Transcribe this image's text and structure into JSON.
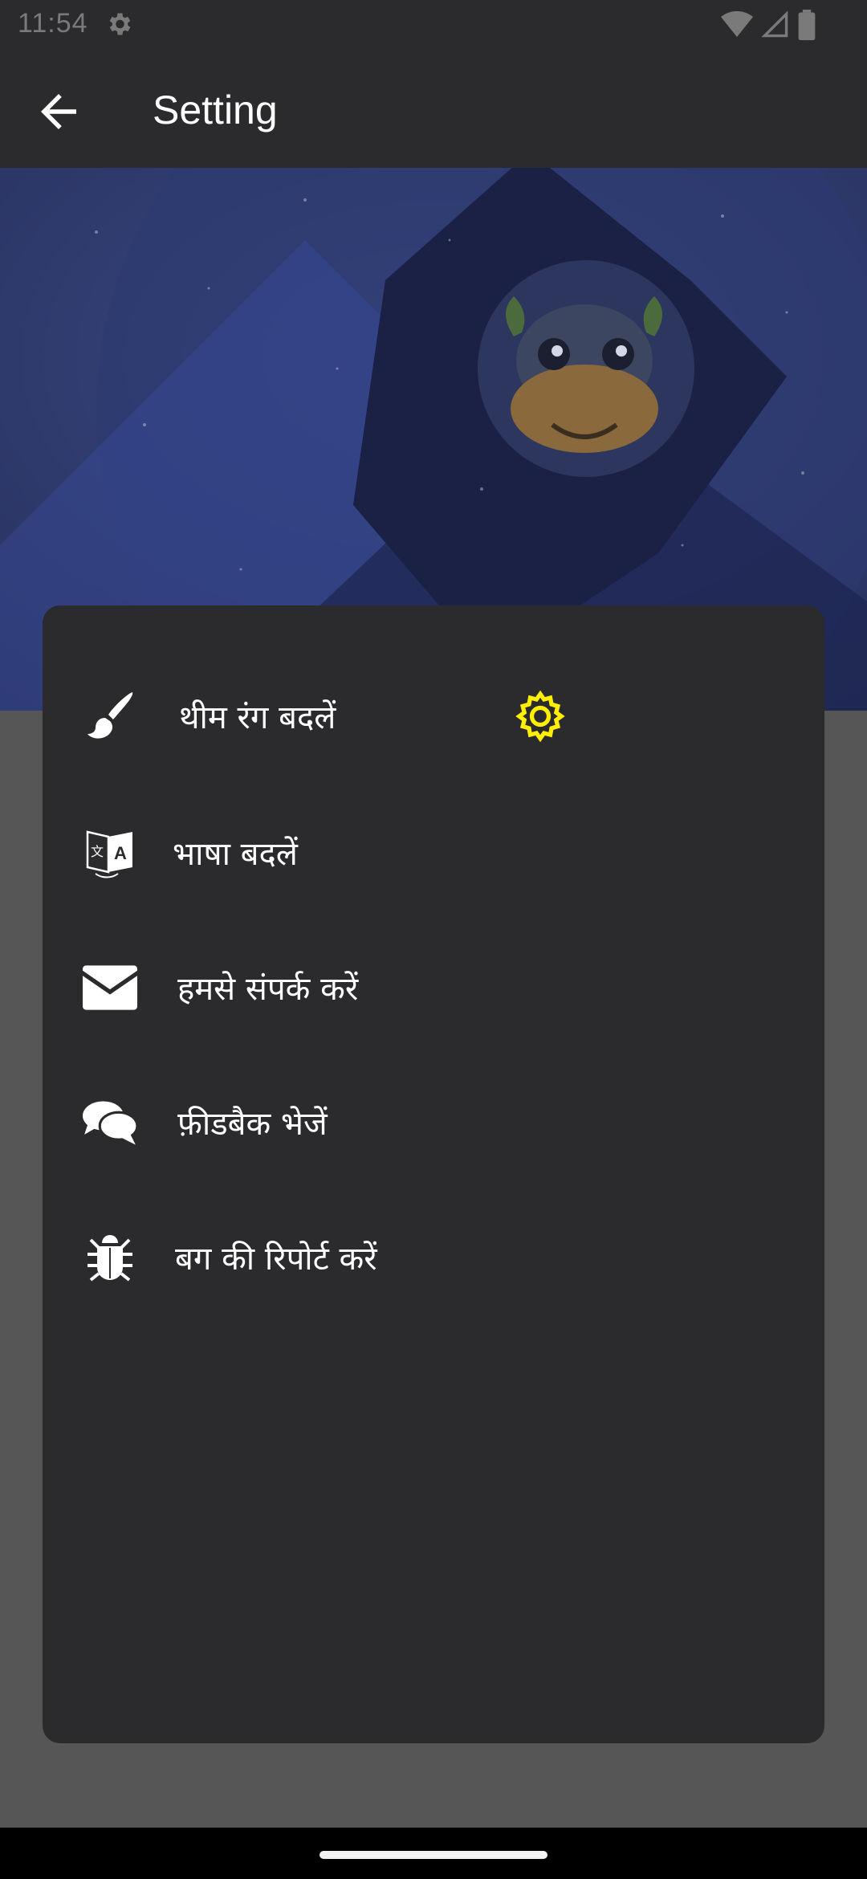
{
  "status_bar": {
    "time": "11:54",
    "icons": [
      "settings-gear-icon",
      "wifi-icon",
      "signal-icon",
      "battery-icon"
    ]
  },
  "app_bar": {
    "title": "Setting",
    "back_icon": "arrow-left-icon"
  },
  "hero": {
    "description_icon": "settings-banner-illustration"
  },
  "menu": {
    "items": [
      {
        "label": "थीम रंग बदलें",
        "icon": "paint-brush-icon",
        "accessory_icon": "gear-icon",
        "accessory_color": "#ffef00"
      },
      {
        "label": "भाषा बदलें",
        "icon": "translate-icon"
      },
      {
        "label": "हमसे संपर्क करें",
        "icon": "envelope-icon"
      },
      {
        "label": "फ़ीडबैक भेजें",
        "icon": "chat-bubbles-icon"
      },
      {
        "label": "बग की रिपोर्ट करें",
        "icon": "bug-icon"
      }
    ]
  },
  "colors": {
    "app_bar": "#2b2a2c",
    "sheet": "#2b2a2c",
    "scrim": "#565656",
    "accent": "#ffef00"
  }
}
